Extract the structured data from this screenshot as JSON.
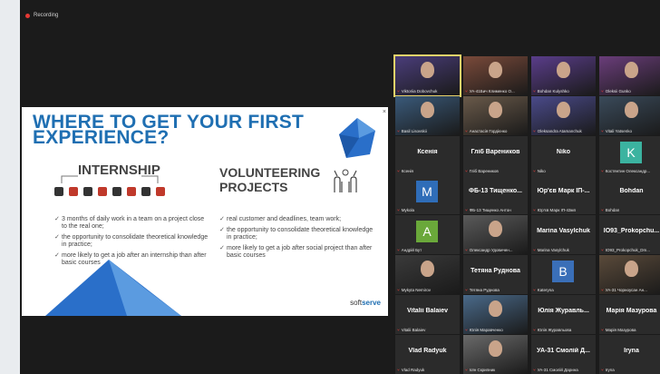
{
  "recording": {
    "label": "Recording"
  },
  "slide": {
    "title_line1": "WHERE TO GET YOUR FIRST",
    "title_line2": "EXPERIENCE?",
    "left": {
      "title": "INTERNSHIP",
      "bullets": [
        "3 months of daily work in a team on a project close to the real one;",
        "the opportunity to consolidate theoretical knowledge in practice;",
        "more likely to get a job after an internship than after basic courses"
      ]
    },
    "right": {
      "title_line1": "VOLUNTEERING",
      "title_line2": "PROJECTS",
      "bullets": [
        "real customer and deadlines, team work;",
        "the opportunity to consolidate theoretical knowledge in practice;",
        "more likely to get a job after social project than after basic courses"
      ]
    },
    "logo_a": "soft",
    "logo_b": "serve",
    "close_glyph": "×"
  },
  "participants": [
    {
      "name": "",
      "label": "Viktoriia Dobovchuk",
      "kind": "photo",
      "color": "#4a3d7a"
    },
    {
      "name": "",
      "label": "УА-41Бич Клименко О...",
      "kind": "photo",
      "color": "#7a4a3a"
    },
    {
      "name": "",
      "label": "Bohdan Kulyshko",
      "kind": "photo",
      "color": "#5a3d8a"
    },
    {
      "name": "",
      "label": "Oleksii Gunko",
      "kind": "photo",
      "color": "#6a3d7a"
    },
    {
      "name": "",
      "label": "Basil Lisovskii",
      "kind": "photo",
      "color": "#3a5a7a"
    },
    {
      "name": "",
      "label": "Анастасія Гордієнко",
      "kind": "photo",
      "color": "#6a5a4a"
    },
    {
      "name": "",
      "label": "Oleksandra Atamanchuk",
      "kind": "photo",
      "color": "#4a4a8a"
    },
    {
      "name": "",
      "label": "Vitali Yatsenko",
      "kind": "photo",
      "color": "#3a4a5a"
    },
    {
      "name": "Ксенія",
      "label": "Ксенія",
      "kind": "text"
    },
    {
      "name": "Гліб Вареников",
      "label": "Гліб Вареников",
      "kind": "text"
    },
    {
      "name": "Niko",
      "label": "Niko",
      "kind": "text"
    },
    {
      "name": "",
      "label": "Костянтин Олександр...",
      "kind": "avatar",
      "letter": "K",
      "color": "#3bb3a0"
    },
    {
      "name": "",
      "label": "Mykola",
      "kind": "avatar",
      "letter": "M",
      "color": "#2f6db8"
    },
    {
      "name": "ФБ-13 Тищенко...",
      "label": "ФБ-13 Тищенко Антон",
      "kind": "text"
    },
    {
      "name": "Юр'єв Марк ІП-...",
      "label": "Юр'єв Марк ІП-43мп",
      "kind": "text"
    },
    {
      "name": "Bohdan",
      "label": "Bohdan",
      "kind": "text"
    },
    {
      "name": "",
      "label": "Андрій Бут",
      "kind": "avatar",
      "letter": "A",
      "color": "#6aa83a"
    },
    {
      "name": "",
      "label": "Олександр Удовичен...",
      "kind": "photo",
      "color": "#5a5a5a"
    },
    {
      "name": "Marina Vasylchuk",
      "label": "Marina Vasylchuk",
      "kind": "text"
    },
    {
      "name": "IO93_Prokopchu...",
      "label": "IO93_Prokopchuk_Dm...",
      "kind": "text"
    },
    {
      "name": "",
      "label": "Mykyta Nemirov",
      "kind": "photo",
      "color": "#3a3a3a"
    },
    {
      "name": "Тетяна Руднова",
      "label": "Тетяна Руднова",
      "kind": "text"
    },
    {
      "name": "",
      "label": "Kateryna",
      "kind": "avatar",
      "letter": "B",
      "color": "#3a6fb8"
    },
    {
      "name": "",
      "label": "УА-31 Чорноусан Ан...",
      "kind": "photo",
      "color": "#5a4a3a"
    },
    {
      "name": "Vitalii Balaiev",
      "label": "Vitalii Balaiev",
      "kind": "text"
    },
    {
      "name": "",
      "label": "Юлія Маравченко",
      "kind": "photo",
      "color": "#4a6a8a"
    },
    {
      "name": "Юлія Журавль...",
      "label": "Юлія Журавльова",
      "kind": "text"
    },
    {
      "name": "Марія Мазурова",
      "label": "Марія Мазурова",
      "kind": "text"
    },
    {
      "name": "Vlad Radyuk",
      "label": "Vlad Radyuk",
      "kind": "text"
    },
    {
      "name": "",
      "label": "Іоїн Скрипник",
      "kind": "photo",
      "color": "#6a6a6a"
    },
    {
      "name": "УА-31 Смолій Д...",
      "label": "УА-31 Смолій Дарина",
      "kind": "text"
    },
    {
      "name": "Iryna",
      "label": "Iryna",
      "kind": "text"
    }
  ]
}
